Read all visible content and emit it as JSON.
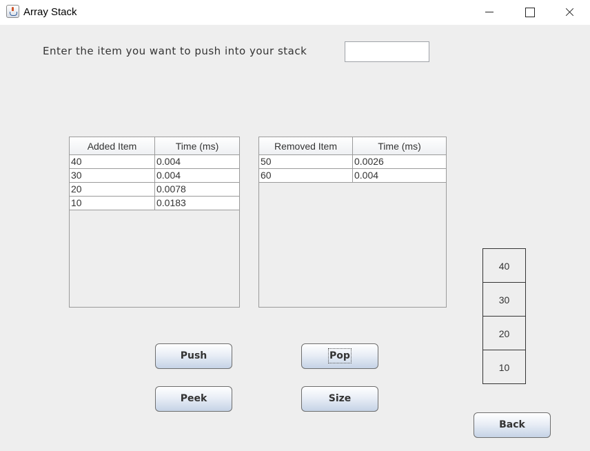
{
  "window": {
    "title": "Array Stack"
  },
  "prompt": {
    "text": "Enter the item you want to push into your stack",
    "input_value": ""
  },
  "added_table": {
    "headers": [
      "Added Item",
      "Time (ms)"
    ],
    "rows": [
      [
        "40",
        "0.004"
      ],
      [
        "30",
        "0.004"
      ],
      [
        "20",
        "0.0078"
      ],
      [
        "10",
        "0.0183"
      ]
    ]
  },
  "removed_table": {
    "headers": [
      "Removed Item",
      "Time (ms)"
    ],
    "rows": [
      [
        "50",
        "0.0026"
      ],
      [
        "60",
        "0.004"
      ]
    ]
  },
  "buttons": {
    "push": "Push",
    "pop": "Pop",
    "peek": "Peek",
    "size": "Size",
    "back": "Back"
  },
  "stack": {
    "items": [
      "40",
      "30",
      "20",
      "10"
    ]
  }
}
